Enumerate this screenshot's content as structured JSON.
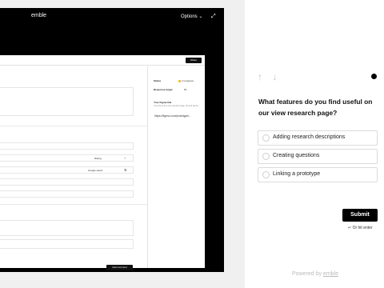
{
  "app": {
    "logo": "emble",
    "options_label": "Options",
    "options_caret": "⌄",
    "expand_icon": "⤢",
    "share_label": "Share",
    "add_comment_label": "Add comment",
    "rows": [
      {
        "tag": "Rating",
        "icon": "↕"
      },
      {
        "tag": "Google select",
        "icon": "⇅"
      }
    ],
    "panel": {
      "status_label": "Status",
      "status_value": "In progress",
      "target_label": "Response target",
      "target_value": "50",
      "figma_label": "Your Figma link",
      "figma_desc": "Your link to the view research page, the link will be ...",
      "figma_link": "https://figma.com/prototype/..."
    }
  },
  "survey": {
    "nav_up": "↑",
    "nav_down": "↓",
    "question": "What features do you find useful on our view research page?",
    "options": [
      {
        "label": "Adding research descriptions"
      },
      {
        "label": "Creating questions"
      },
      {
        "label": "Linking a prototype"
      }
    ],
    "submit_label": "Submit",
    "hint": "↵ Or hit enter",
    "powered_prefix": "Powered by",
    "powered_brand": "emble"
  }
}
